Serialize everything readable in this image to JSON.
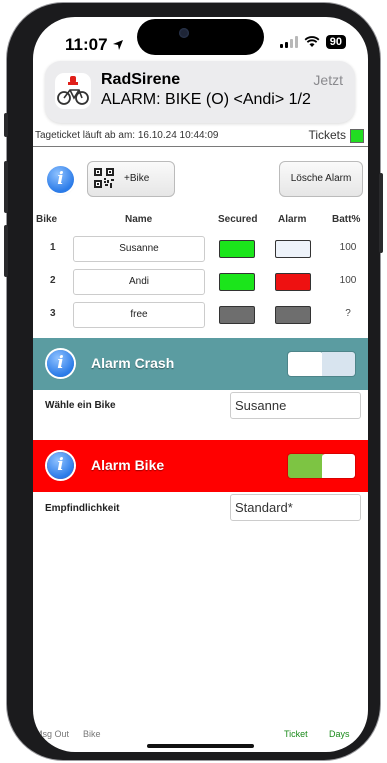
{
  "status_bar": {
    "time": "11:07",
    "battery": "90"
  },
  "notification": {
    "app_name": "RadSirene",
    "message": "ALARM: BIKE (O) <Andi> 1/2",
    "time": "Jetzt"
  },
  "ticket_bar": {
    "info": "Tageticket läuft ab am: 16.10.24 10:44:09",
    "tickets_label": "Tickets",
    "tickets_color": "#22dd22"
  },
  "toolbar": {
    "info_icon": "i",
    "add_bike_label": "+Bike",
    "delete_alarm_label": "Lösche Alarm"
  },
  "bike_table": {
    "headers": {
      "bike": "Bike",
      "name": "Name",
      "secured": "Secured",
      "alarm": "Alarm",
      "battery": "Batt%"
    },
    "rows": [
      {
        "num": "1",
        "name": "Susanne",
        "secured_color": "#1be51b",
        "alarm_color": "#eef3fa",
        "battery": "100"
      },
      {
        "num": "2",
        "name": "Andi",
        "secured_color": "#1be51b",
        "alarm_color": "#ee1111",
        "battery": "100"
      },
      {
        "num": "3",
        "name": "free",
        "secured_color": "#6e6e6e",
        "alarm_color": "#6e6e6e",
        "battery": "?"
      }
    ]
  },
  "alarm_crash": {
    "title": "Alarm Crash",
    "band_color": "#5b9ca1",
    "enabled": false,
    "choose_bike_label": "Wähle ein Bike",
    "choose_bike_value": "Susanne"
  },
  "alarm_bike": {
    "title": "Alarm Bike",
    "band_color": "#ff0000",
    "enabled": true,
    "sensitivity_label": "Empfindlichkeit",
    "sensitivity_value": "Standard*"
  },
  "tabbar": {
    "msg_out": "Msg Out",
    "bike": "Bike",
    "ticket": "Ticket",
    "days": "Days"
  }
}
